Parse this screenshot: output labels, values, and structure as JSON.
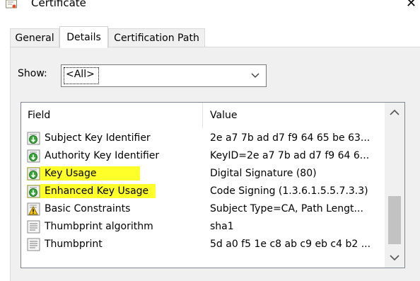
{
  "window": {
    "title": "Certificate",
    "close_label": "✕"
  },
  "tabs": [
    {
      "label": "General",
      "active": false
    },
    {
      "label": "Details",
      "active": true
    },
    {
      "label": "Certification Path",
      "active": false
    }
  ],
  "show": {
    "label": "Show:",
    "selected": "<All>"
  },
  "columns": {
    "field": "Field",
    "value": "Value"
  },
  "rows": [
    {
      "field": "Subject Key Identifier",
      "value": "2e a7 7b ad d7 f9 64 65 be 63...",
      "icon": "extension-green-icon",
      "highlighted": false
    },
    {
      "field": "Authority Key Identifier",
      "value": "KeyID=2e a7 7b ad d7 f9 64 6...",
      "icon": "extension-green-icon",
      "highlighted": false
    },
    {
      "field": "Key Usage",
      "value": "Digital Signature (80)",
      "icon": "extension-green-icon",
      "highlighted": true
    },
    {
      "field": "Enhanced Key Usage",
      "value": "Code Signing (1.3.6.1.5.5.7.3.3)",
      "icon": "extension-green-icon",
      "highlighted": true
    },
    {
      "field": "Basic Constraints",
      "value": "Subject Type=CA, Path Lengt...",
      "icon": "extension-warning-icon",
      "highlighted": false
    },
    {
      "field": "Thumbprint algorithm",
      "value": "sha1",
      "icon": "property-document-icon",
      "highlighted": false
    },
    {
      "field": "Thumbprint",
      "value": "5d a0 f5 1e c8 ab c9 eb c4 b2 ...",
      "icon": "property-document-icon",
      "highlighted": false
    }
  ],
  "colors": {
    "highlight": "#ffff2a",
    "panel": "#f0f0f0",
    "border": "#828790"
  }
}
